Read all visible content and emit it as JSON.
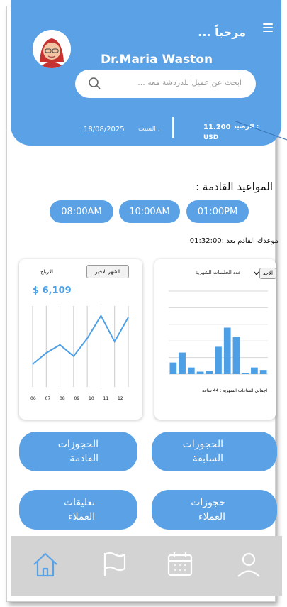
{
  "header": {
    "welcome": "مرحباً ...",
    "doctor_name": "Dr.Maria Waston",
    "search_placeholder": "ابحث عن عميل للدردشة معه ...",
    "date": "18/08/2025",
    "day": "السبت ,",
    "balance_label": "الرصيد :",
    "balance_value": "11.200",
    "currency": "USD"
  },
  "appointments": {
    "title": "المواعيد القادمة :",
    "times": [
      "08:00AM",
      "10:00AM",
      "01:00PM"
    ],
    "next_text": "موعدك القادم بعد :01:32:00"
  },
  "profit_card": {
    "title": "الارباح",
    "filter": "الشهر الاخير",
    "total": "$ 6,109",
    "x_labels": [
      "06",
      "07",
      "08",
      "09",
      "10",
      "11",
      "12"
    ]
  },
  "sessions_card": {
    "title": "عدد الجلسات الشهرية",
    "filter": "الاحد",
    "footer": "اجمالي الساعات الشهرية : 44 ساعة"
  },
  "chart_data": [
    {
      "type": "line",
      "title": "الارباح",
      "x": [
        "06",
        "07",
        "08",
        "09",
        "10",
        "11",
        "12"
      ],
      "series": [
        {
          "values": [
            0.28,
            0.42,
            0.52,
            0.38,
            0.6,
            0.88,
            0.56,
            0.86
          ]
        }
      ],
      "ylim": [
        0,
        1
      ],
      "grid": true
    },
    {
      "type": "bar",
      "title": "عدد الجلسات الشهرية",
      "values": [
        0.14,
        0.26,
        0.08,
        0.03,
        0.04,
        0.33,
        0.56,
        0.45,
        0.01,
        0.08,
        0.05
      ],
      "ylim": [
        0,
        1
      ],
      "grid": true
    }
  ],
  "actions": [
    {
      "line1": "الحجوزات",
      "line2": "القادمة"
    },
    {
      "line1": "الحجوزات",
      "line2": "السابقة"
    },
    {
      "line1": "تعليقات",
      "line2": "العملاء"
    },
    {
      "line1": "حجوزات",
      "line2": "العملاء"
    }
  ],
  "nav": {
    "items": [
      "home-icon",
      "flag-icon",
      "calendar-icon",
      "user-icon"
    ],
    "active_color": "#5aa1e6",
    "inactive_color": "#ffffff"
  },
  "colors": {
    "accent": "#5aa1e6",
    "header_bg": "#5aa1e6"
  }
}
